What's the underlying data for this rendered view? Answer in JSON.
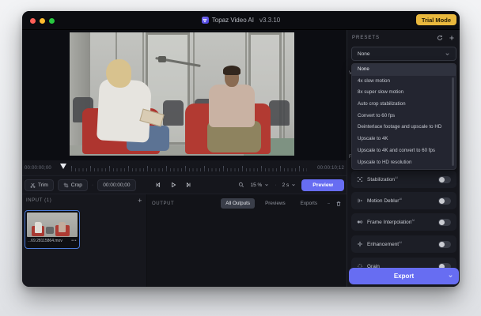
{
  "window": {
    "titlebar": {
      "app_name": "Topaz Video AI",
      "version": "v3.3.10",
      "trial_badge": "Trial Mode"
    },
    "timeline": {
      "start_timecode": "00:00:00;00",
      "end_timecode": "00:00:10;12"
    },
    "toolbar": {
      "trim_label": "Trim",
      "crop_label": "Crop",
      "separator": "·",
      "timecode_value": "00:00:00;00",
      "zoom_value": "15 %",
      "preview_duration_value": "2 s",
      "preview_label": "Preview"
    },
    "input_panel": {
      "header": "INPUT (1)",
      "add_label": "+",
      "clip_filename": "...69.28115864.mov",
      "clip_more": "•••"
    },
    "output_panel": {
      "header": "OUTPUT",
      "tabs": [
        "All Outputs",
        "Previews",
        "Exports"
      ],
      "active_tab": "All Outputs"
    },
    "presets": {
      "header": "PRESETS",
      "selected_value": "None",
      "options": [
        "None",
        "4x slow motion",
        "8x super slow motion",
        "Auto crop stabilization",
        "Convert to 60 fps",
        "Deinterlace footage and upscale to HD",
        "Upscale to 4K",
        "Upscale to 4K and convert to 60 fps",
        "Upscale to HD resolution"
      ],
      "clipped_label_top": "VI",
      "clipped_label_bottom": "FI"
    },
    "filters": [
      {
        "label": "Stabilization",
        "sup": "AI",
        "enabled": false
      },
      {
        "label": "Motion Deblur",
        "sup": "AI",
        "enabled": false
      },
      {
        "label": "Frame Interpolation",
        "sup": "AI",
        "enabled": false
      },
      {
        "label": "Enhancement",
        "sup": "AI",
        "enabled": false
      },
      {
        "label": "Grain",
        "sup": "",
        "enabled": false
      }
    ],
    "export_label": "Export"
  },
  "colors": {
    "accent": "#676df2",
    "trial_badge_bg": "#e9b83d",
    "selection_blue": "#4a7ad8",
    "traffic_red": "#ff5f57",
    "traffic_yellow": "#febc2e",
    "traffic_green": "#28c840"
  }
}
